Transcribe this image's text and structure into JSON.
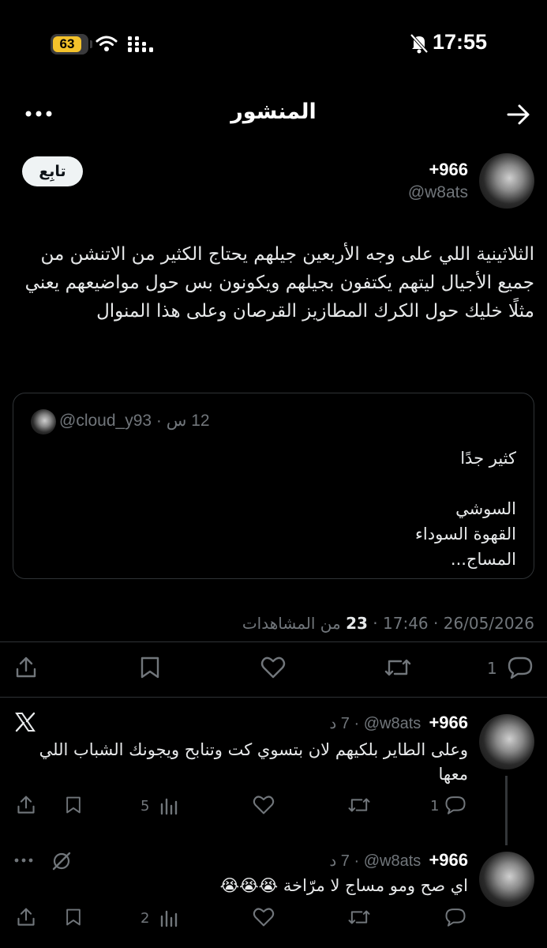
{
  "status_bar": {
    "time": "17:55",
    "battery": "63"
  },
  "header": {
    "title": "المنشور"
  },
  "post": {
    "author_name": "+966",
    "author_handle": "@w8ats",
    "follow_label": "تابِع",
    "text": "الثلاثينية اللي على وجه الأربعين جيلهم يحتاج الكثير من الاتنشن من جميع الأجيال ليتهم يكتفون بجيلهم ويكونون بس حول مواضيعهم يعني مثلًا خليك حول الكرك المطازيز القرصان وعلى هذا المنوال",
    "quote": {
      "handle": "@cloud_y93",
      "time": "12 س",
      "text": "كثير جدًا\n\nالسوشي\nالقهوة السوداء\nالمساج..."
    },
    "date": "26/05/2026",
    "time": "17:46",
    "views": "23",
    "views_label": "من المشاهدات",
    "reply_count": "1"
  },
  "replies": [
    {
      "name": "+966",
      "handle": "@w8ats",
      "age": "7 د",
      "text": "وعلى الطاير بلكيهم لان بتسوي كت وتنابح ويجونك الشباب اللي\nمعها",
      "replies": "1",
      "views": "5"
    },
    {
      "name": "+966",
      "handle": "@w8ats",
      "age": "7 د",
      "text": "اي صح ومو مساج لا مرّاخة 😭😭😭",
      "views": "2"
    }
  ],
  "colors": {
    "background": "#000000",
    "text": "#e7e9ea",
    "muted": "#71767b",
    "divider": "#2f3336",
    "battery": "#f4c22b"
  }
}
